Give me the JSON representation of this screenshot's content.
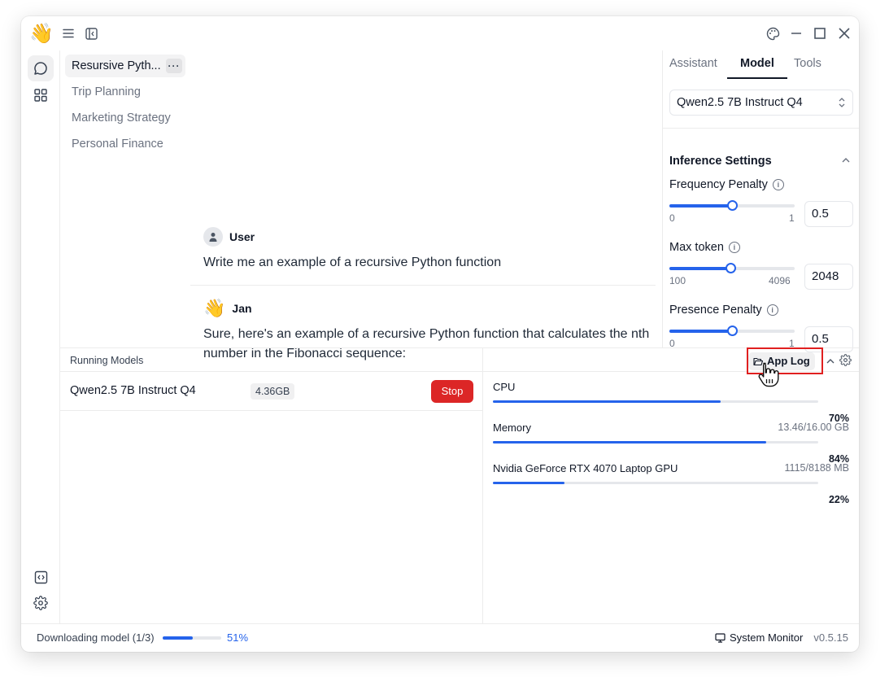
{
  "app": {
    "logo_emoji": "👋"
  },
  "threads": [
    {
      "label": "Resursive Pyth...",
      "active": true
    },
    {
      "label": "Trip Planning"
    },
    {
      "label": "Marketing Strategy"
    },
    {
      "label": "Personal Finance"
    }
  ],
  "chat": {
    "messages": [
      {
        "author": "User",
        "text": "Write me an example of a recursive Python function"
      },
      {
        "author": "Jan",
        "avatar_emoji": "👋",
        "text": "Sure, here's an example of a recursive Python function that calculates the nth number in the Fibonacci sequence:"
      }
    ]
  },
  "right_panel": {
    "tabs": [
      "Assistant",
      "Model",
      "Tools"
    ],
    "active_tab": "Model",
    "selected_model": "Qwen2.5 7B Instruct Q4",
    "section_title": "Inference Settings",
    "params": [
      {
        "label": "Frequency Penalty",
        "min": "0",
        "max": "1",
        "value": "0.5",
        "fraction": 0.5
      },
      {
        "label": "Max token",
        "min": "100",
        "max": "4096",
        "value": "2048",
        "fraction": 0.49
      },
      {
        "label": "Presence Penalty",
        "min": "0",
        "max": "1",
        "value": "0.5",
        "fraction": 0.5
      }
    ]
  },
  "running_models": {
    "header": "Running Models",
    "rows": [
      {
        "name": "Qwen2.5 7B Instruct Q4",
        "size": "4.36GB",
        "action": "Stop"
      }
    ]
  },
  "monitor": {
    "app_log_label": "App Log",
    "items": [
      {
        "label": "CPU",
        "detail": "",
        "percent": "70%",
        "fraction": 0.7
      },
      {
        "label": "Memory",
        "detail": "13.46/16.00 GB",
        "percent": "84%",
        "fraction": 0.84
      },
      {
        "label": "Nvidia GeForce RTX 4070 Laptop GPU",
        "detail": "1115/8188 MB",
        "percent": "22%",
        "fraction": 0.22
      }
    ]
  },
  "status_bar": {
    "download_text": "Downloading model (1/3)",
    "download_percent": "51%",
    "download_fraction": 0.51,
    "system_monitor_label": "System Monitor",
    "version": "v0.5.15"
  },
  "colors": {
    "accent": "#2563eb",
    "danger": "#dc2626",
    "highlight": "#e02020"
  }
}
